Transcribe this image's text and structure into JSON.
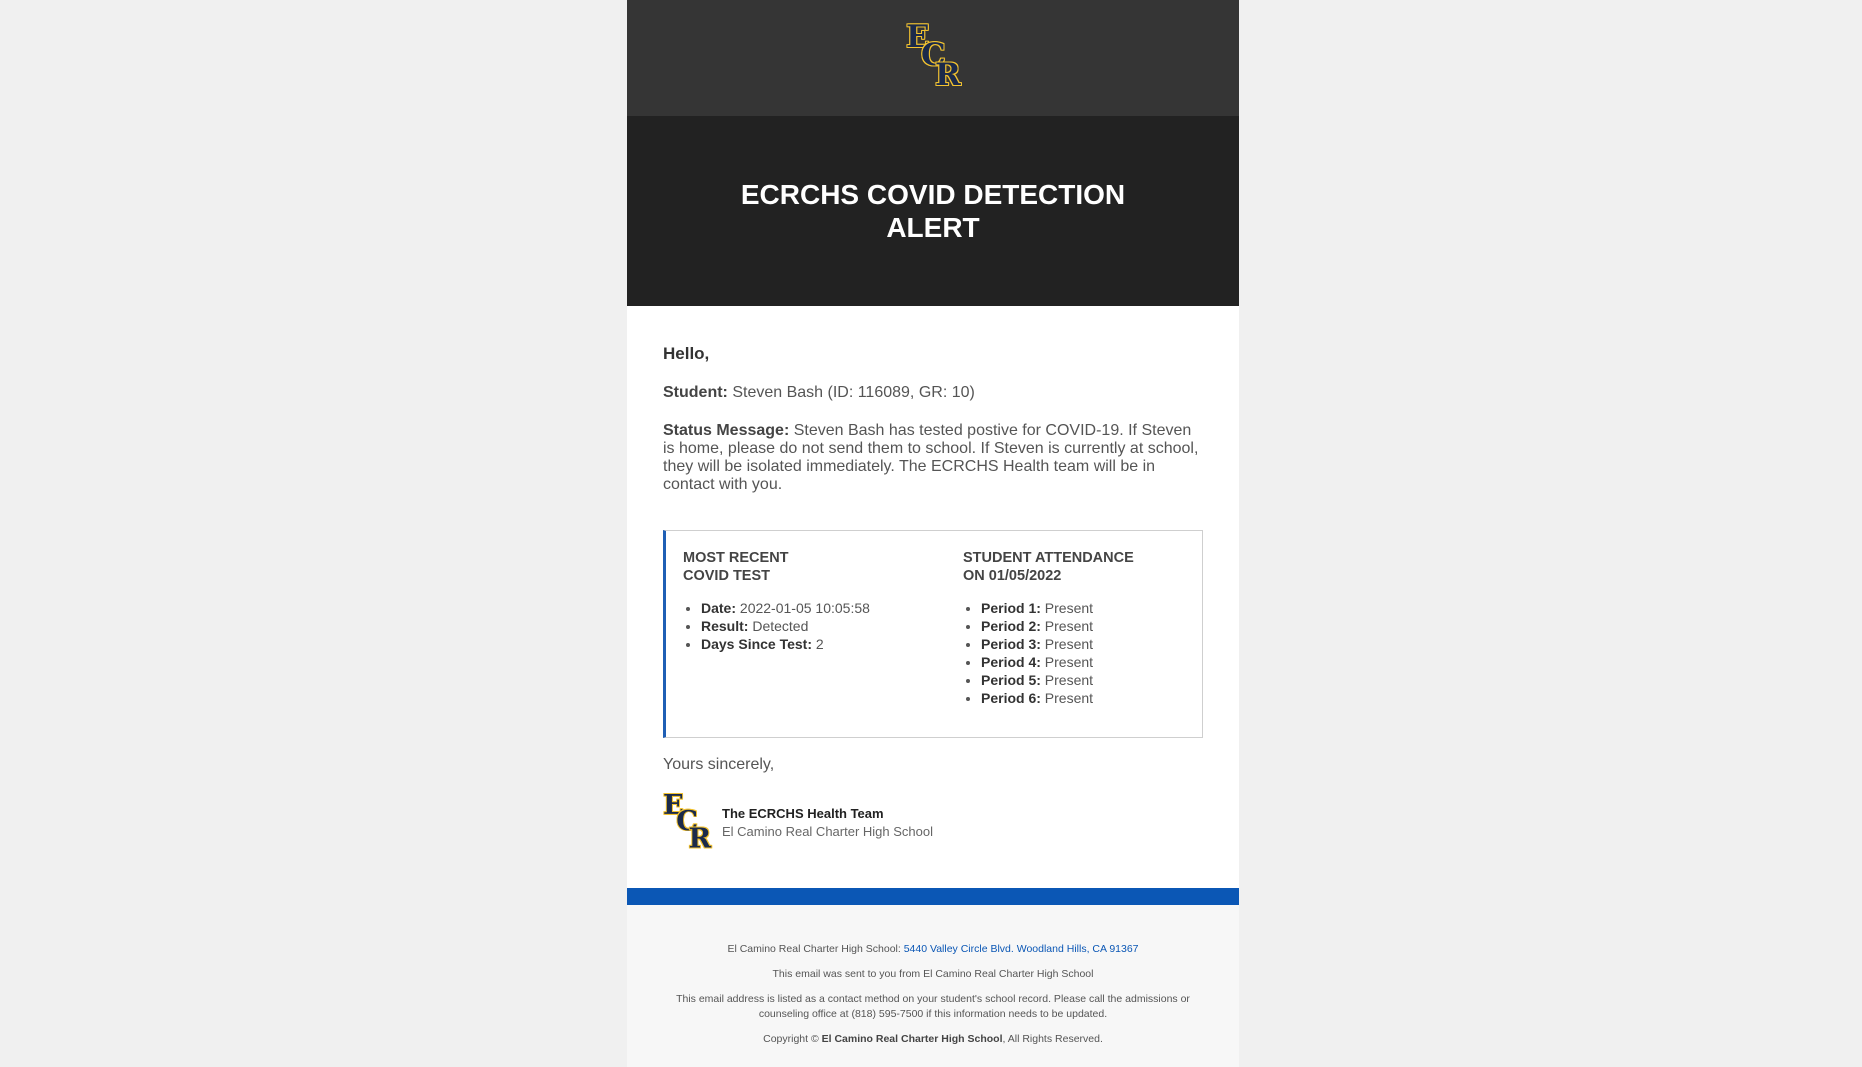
{
  "header": {
    "logo_letters": [
      "E",
      "C",
      "R"
    ],
    "title": "ECRCHS COVID DETECTION ALERT"
  },
  "body": {
    "greeting": "Hello,",
    "student_label": "Student:",
    "student_value": "Steven Bash (ID: 116089, GR: 10)",
    "status_label": "Status Message:",
    "status_value": "Steven Bash has tested postive for COVID-19. If Steven is home, please do not send them to school. If Steven is currently at school, they will be isolated immediately. The ECRCHS Health team will be in contact with you."
  },
  "test_card": {
    "heading_line1": "MOST RECENT",
    "heading_line2": "COVID TEST",
    "items": [
      {
        "label": "Date:",
        "value": "2022-01-05 10:05:58"
      },
      {
        "label": "Result:",
        "value": "Detected"
      },
      {
        "label": "Days Since Test:",
        "value": "2"
      }
    ]
  },
  "attendance_card": {
    "heading_line1": "STUDENT ATTENDANCE",
    "heading_line2": "ON 01/05/2022",
    "items": [
      {
        "label": "Period 1:",
        "value": "Present"
      },
      {
        "label": "Period 2:",
        "value": "Present"
      },
      {
        "label": "Period 3:",
        "value": "Present"
      },
      {
        "label": "Period 4:",
        "value": "Present"
      },
      {
        "label": "Period 5:",
        "value": "Present"
      },
      {
        "label": "Period 6:",
        "value": "Present"
      }
    ]
  },
  "signature": {
    "closing": "Yours sincerely,",
    "team": "The ECRCHS Health Team",
    "school": "El Camino Real Charter High School"
  },
  "footer": {
    "address_prefix": "El Camino Real Charter High School:",
    "address_link": "5440 Valley Circle Blvd. Woodland Hills, CA 91367",
    "sent_from": "This email was sent to you from El Camino Real Charter High School",
    "contact_note": "This email address is listed as a contact method on your student's school record. Please call the admissions or counseling office at (818) 595-7500 if this information needs to be updated.",
    "copyright_prefix": "Copyright ©",
    "copyright_name": "El Camino Real Charter High School",
    "copyright_suffix": ", All Rights Reserved."
  },
  "colors": {
    "logo_band": "#353535",
    "title_band": "#222222",
    "accent_blue": "#0b57b5",
    "logo_gold": "#f2c230",
    "logo_navy": "#1b2a4a"
  }
}
